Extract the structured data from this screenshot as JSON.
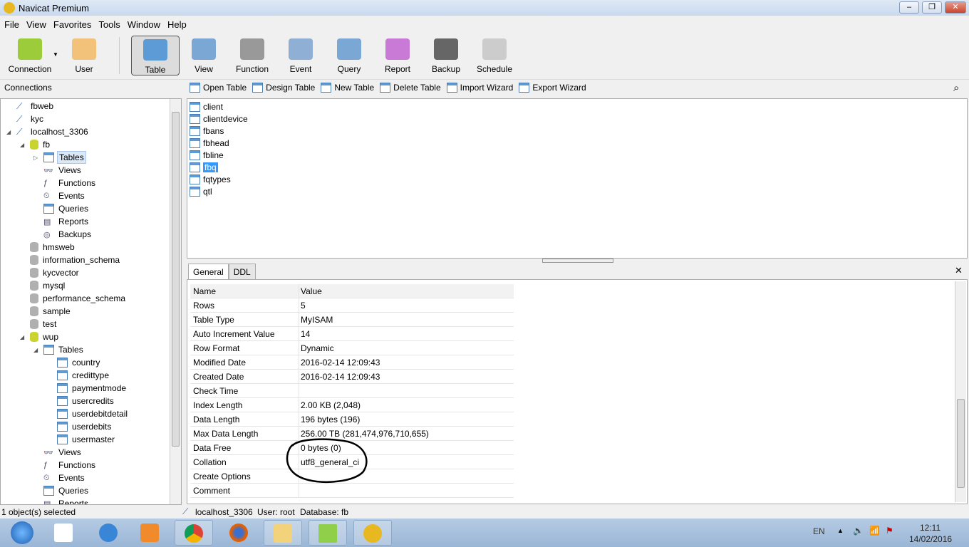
{
  "window": {
    "title": "Navicat Premium"
  },
  "menu": [
    "File",
    "View",
    "Favorites",
    "Tools",
    "Window",
    "Help"
  ],
  "toolbar": [
    {
      "label": "Connection",
      "color": "#9ccc3a"
    },
    {
      "label": "User",
      "color": "#f2c27a"
    },
    {
      "label": "Table",
      "color": "#5d9bd6",
      "selected": true
    },
    {
      "label": "View",
      "color": "#7ba7d4"
    },
    {
      "label": "Function",
      "color": "#999999"
    },
    {
      "label": "Event",
      "color": "#8fb0d4"
    },
    {
      "label": "Query",
      "color": "#7ba7d4"
    },
    {
      "label": "Report",
      "color": "#c87ad6"
    },
    {
      "label": "Backup",
      "color": "#666666"
    },
    {
      "label": "Schedule",
      "color": "#cccccc"
    }
  ],
  "connections_header": "Connections",
  "object_toolbar": [
    "Open Table",
    "Design Table",
    "New Table",
    "Delete Table",
    "Import Wizard",
    "Export Wizard"
  ],
  "tree": [
    {
      "label": "fbweb",
      "level": 0,
      "icon": "conn"
    },
    {
      "label": "kyc",
      "level": 0,
      "icon": "conn"
    },
    {
      "label": "localhost_3306",
      "level": 0,
      "icon": "conn",
      "exp": "open"
    },
    {
      "label": "fb",
      "level": 1,
      "icon": "dbopen",
      "exp": "open"
    },
    {
      "label": "Tables",
      "level": 2,
      "icon": "table",
      "exp": "closed",
      "hl": true
    },
    {
      "label": "Views",
      "level": 2,
      "icon": "view"
    },
    {
      "label": "Functions",
      "level": 2,
      "icon": "func"
    },
    {
      "label": "Events",
      "level": 2,
      "icon": "event"
    },
    {
      "label": "Queries",
      "level": 2,
      "icon": "table"
    },
    {
      "label": "Reports",
      "level": 2,
      "icon": "report"
    },
    {
      "label": "Backups",
      "level": 2,
      "icon": "backup"
    },
    {
      "label": "hmsweb",
      "level": 1,
      "icon": "db"
    },
    {
      "label": "information_schema",
      "level": 1,
      "icon": "db"
    },
    {
      "label": "kycvector",
      "level": 1,
      "icon": "db"
    },
    {
      "label": "mysql",
      "level": 1,
      "icon": "db"
    },
    {
      "label": "performance_schema",
      "level": 1,
      "icon": "db"
    },
    {
      "label": "sample",
      "level": 1,
      "icon": "db"
    },
    {
      "label": "test",
      "level": 1,
      "icon": "db"
    },
    {
      "label": "wup",
      "level": 1,
      "icon": "dbopen",
      "exp": "open"
    },
    {
      "label": "Tables",
      "level": 2,
      "icon": "table",
      "exp": "open"
    },
    {
      "label": "country",
      "level": 3,
      "icon": "table"
    },
    {
      "label": "credittype",
      "level": 3,
      "icon": "table"
    },
    {
      "label": "paymentmode",
      "level": 3,
      "icon": "table"
    },
    {
      "label": "usercredits",
      "level": 3,
      "icon": "table"
    },
    {
      "label": "userdebitdetail",
      "level": 3,
      "icon": "table"
    },
    {
      "label": "userdebits",
      "level": 3,
      "icon": "table"
    },
    {
      "label": "usermaster",
      "level": 3,
      "icon": "table"
    },
    {
      "label": "Views",
      "level": 2,
      "icon": "view"
    },
    {
      "label": "Functions",
      "level": 2,
      "icon": "func"
    },
    {
      "label": "Events",
      "level": 2,
      "icon": "event"
    },
    {
      "label": "Queries",
      "level": 2,
      "icon": "table"
    },
    {
      "label": "Reports",
      "level": 2,
      "icon": "report"
    }
  ],
  "objects": [
    {
      "name": "client"
    },
    {
      "name": "clientdevice"
    },
    {
      "name": "fbans"
    },
    {
      "name": "fbhead"
    },
    {
      "name": "fbline"
    },
    {
      "name": "fbq",
      "selected": true
    },
    {
      "name": "fqtypes"
    },
    {
      "name": "qtl"
    }
  ],
  "tabs": [
    "General",
    "DDL"
  ],
  "properties": {
    "header": [
      "Name",
      "Value"
    ],
    "rows": [
      [
        "Rows",
        "5"
      ],
      [
        "Table Type",
        "MyISAM"
      ],
      [
        "Auto Increment Value",
        "14"
      ],
      [
        "Row Format",
        "Dynamic"
      ],
      [
        "Modified Date",
        "2016-02-14 12:09:43"
      ],
      [
        "Created Date",
        "2016-02-14 12:09:43"
      ],
      [
        "Check Time",
        ""
      ],
      [
        "Index Length",
        "2.00 KB (2,048)"
      ],
      [
        "Data Length",
        "196 bytes (196)"
      ],
      [
        "Max Data Length",
        "256.00 TB (281,474,976,710,655)"
      ],
      [
        "Data Free",
        "0 bytes (0)"
      ],
      [
        "Collation",
        "utf8_general_ci"
      ],
      [
        "Create Options",
        ""
      ],
      [
        "Comment",
        ""
      ]
    ]
  },
  "status": {
    "selected": "1 object(s) selected",
    "connection": "localhost_3306",
    "user": "User: root",
    "database": "Database: fb"
  },
  "taskbar": {
    "lang": "EN",
    "time": "12:11",
    "date": "14/02/2016"
  }
}
